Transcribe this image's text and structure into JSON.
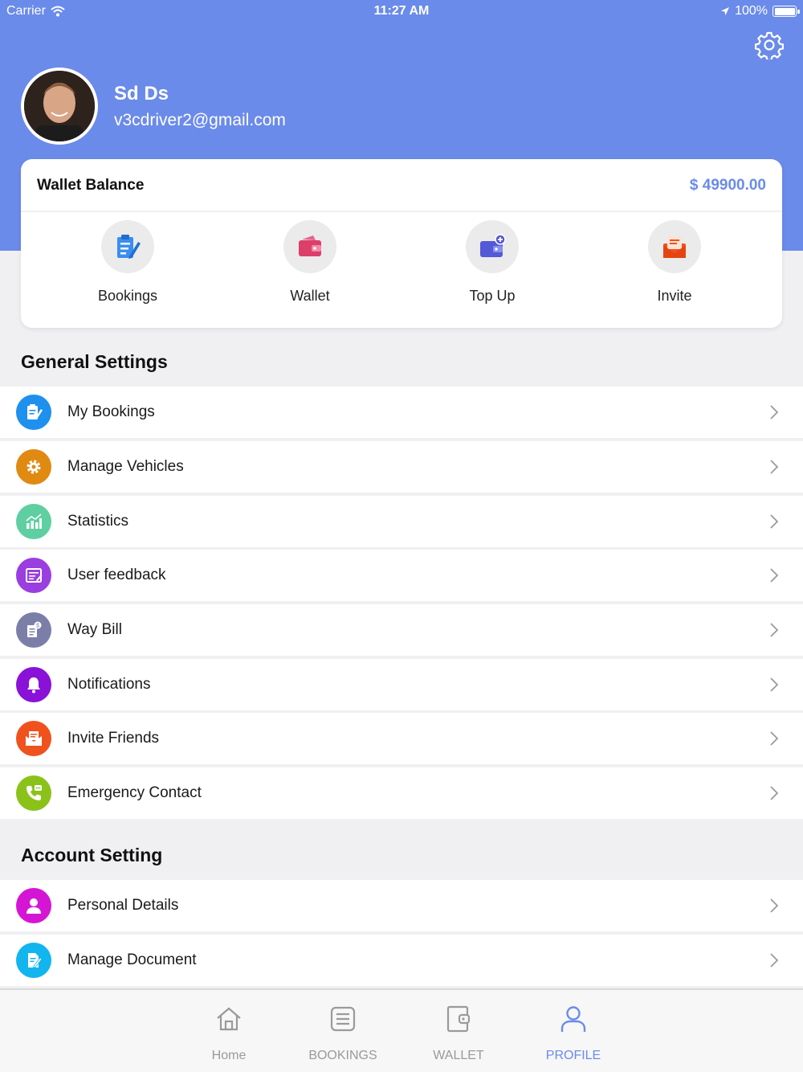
{
  "status_bar": {
    "carrier": "Carrier",
    "time": "11:27 AM",
    "battery": "100%"
  },
  "profile": {
    "name": "Sd Ds",
    "email": "v3cdriver2@gmail.com"
  },
  "wallet": {
    "title": "Wallet Balance",
    "amount": "$ 49900.00",
    "actions": [
      {
        "label": "Bookings",
        "icon": "clipboard-edit-icon"
      },
      {
        "label": "Wallet",
        "icon": "wallet-icon"
      },
      {
        "label": "Top Up",
        "icon": "wallet-add-icon"
      },
      {
        "label": "Invite",
        "icon": "envelope-icon"
      }
    ]
  },
  "general_settings": {
    "title": "General Settings",
    "items": [
      {
        "label": "My Bookings",
        "icon": "clipboard-edit-icon",
        "color": "#1e90ee"
      },
      {
        "label": "Manage Vehicles",
        "icon": "gear-icon",
        "color": "#e08a12"
      },
      {
        "label": "Statistics",
        "icon": "bar-chart-icon",
        "color": "#5fcfa2"
      },
      {
        "label": "User feedback",
        "icon": "feedback-icon",
        "color": "#9a3ee0"
      },
      {
        "label": "Way Bill",
        "icon": "bill-icon",
        "color": "#7b7fa8"
      },
      {
        "label": "Notifications",
        "icon": "bell-icon",
        "color": "#8a12d8"
      },
      {
        "label": "Invite Friends",
        "icon": "envelope-icon",
        "color": "#f0521e"
      },
      {
        "label": "Emergency Contact",
        "icon": "phone-icon",
        "color": "#8bc21a"
      }
    ]
  },
  "account_setting": {
    "title": "Account Setting",
    "items": [
      {
        "label": "Personal Details",
        "icon": "person-icon",
        "color": "#d416d4"
      },
      {
        "label": "Manage Document",
        "icon": "document-edit-icon",
        "color": "#12b5ee"
      }
    ]
  },
  "tabs": [
    {
      "label": "Home",
      "icon": "home-icon",
      "active": false
    },
    {
      "label": "BOOKINGS",
      "icon": "list-icon",
      "active": false
    },
    {
      "label": "WALLET",
      "icon": "wallet-icon",
      "active": false
    },
    {
      "label": "PROFILE",
      "icon": "person-icon",
      "active": true
    }
  ],
  "colors": {
    "accent": "#6b8bea",
    "background": "#f0f0f2"
  }
}
